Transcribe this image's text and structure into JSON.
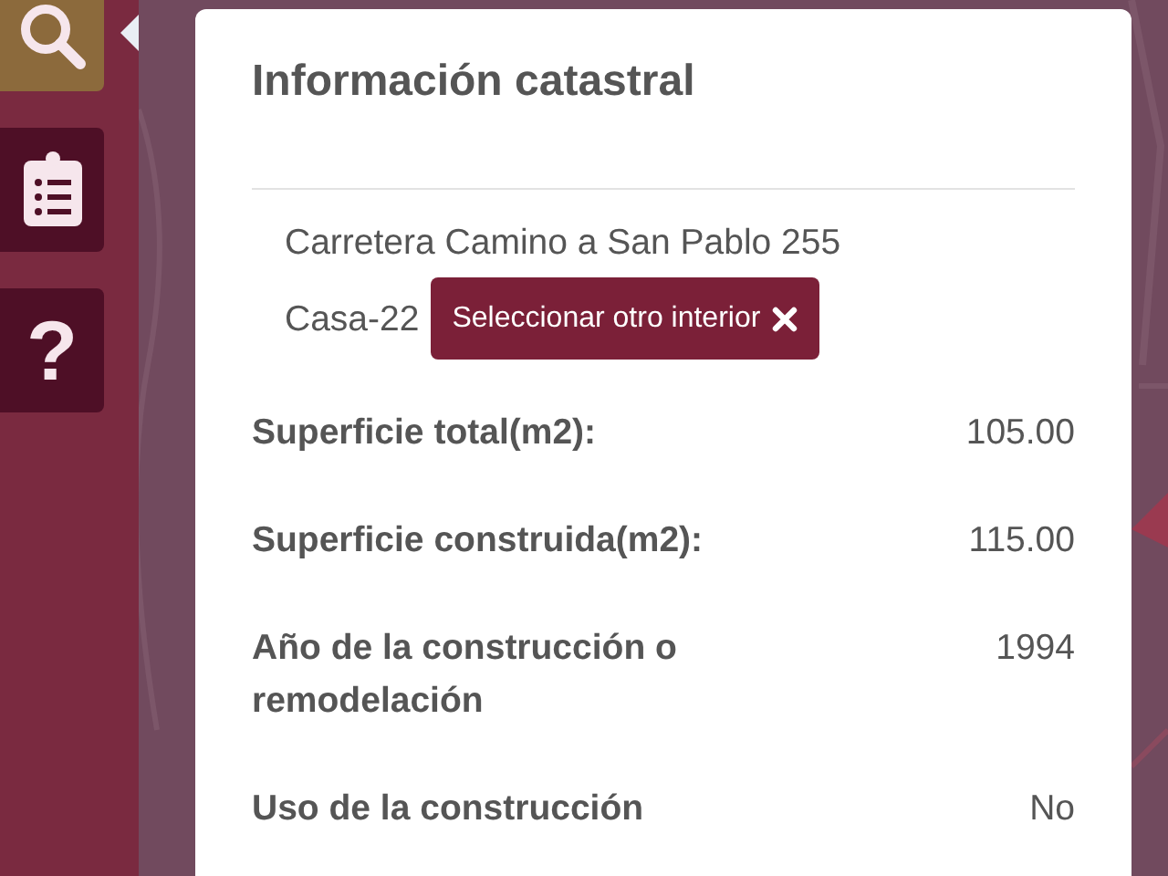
{
  "sidebar": {
    "buttons": [
      {
        "kind": "search",
        "selected": true
      },
      {
        "kind": "list",
        "selected": false
      },
      {
        "kind": "help",
        "symbol": "?",
        "selected": false
      }
    ]
  },
  "panel": {
    "title": "Información catastral",
    "address": "Carretera Camino a San Pablo 255",
    "interior": "Casa-22",
    "change_button": "Seleccionar otro interior",
    "fields": [
      {
        "label": "Superficie total(m2):",
        "value": "105.00"
      },
      {
        "label": "Superficie construida(m2):",
        "value": "115.00"
      },
      {
        "label": "Año de la construcción o remodelación",
        "value": "1994"
      },
      {
        "label": "Uso de la construcción",
        "value": "No"
      }
    ]
  }
}
